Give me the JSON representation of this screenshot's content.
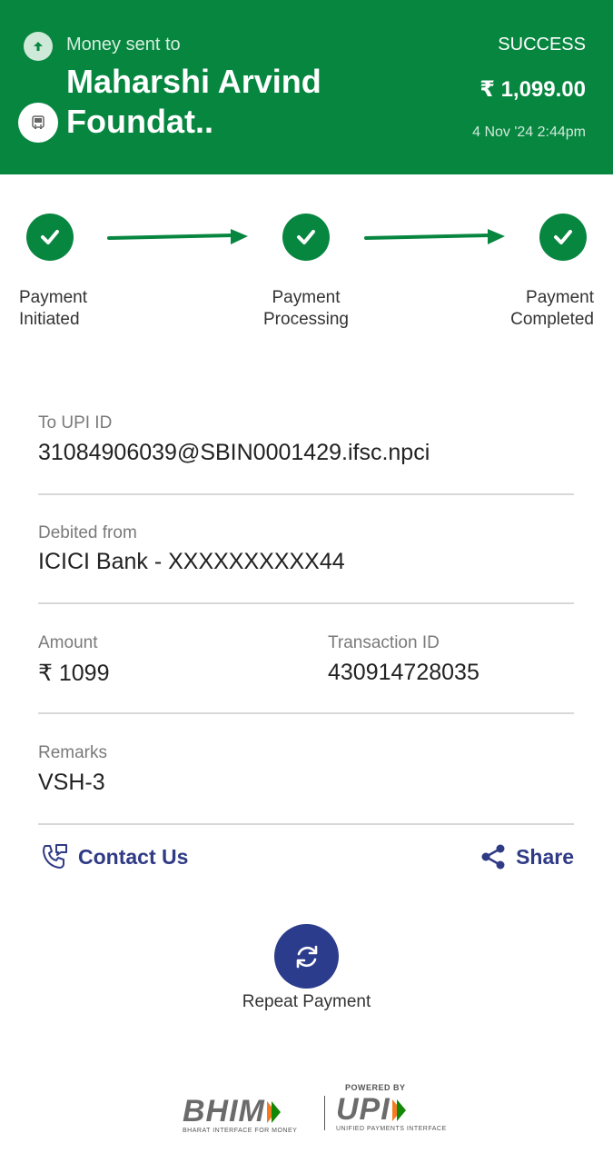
{
  "header": {
    "sent_label": "Money sent to",
    "name": "Maharshi Arvind Foundat..",
    "status": "SUCCESS",
    "amount": "₹ 1,099.00",
    "datetime": "4 Nov '24 2:44pm",
    "bg_color": "#078640"
  },
  "steps": [
    {
      "label_line1": "Payment",
      "label_line2": "Initiated"
    },
    {
      "label_line1": "Payment",
      "label_line2": "Processing"
    },
    {
      "label_line1": "Payment",
      "label_line2": "Completed"
    }
  ],
  "details": {
    "upi": {
      "label": "To UPI ID",
      "value": "31084906039@SBIN0001429.ifsc.npci"
    },
    "debited": {
      "label": "Debited from",
      "value": "ICICI Bank - XXXXXXXXXX44"
    },
    "amount": {
      "label": "Amount",
      "value": "₹ 1099"
    },
    "txn": {
      "label": "Transaction ID",
      "value": "430914728035"
    },
    "remarks": {
      "label": "Remarks",
      "value": "VSH-3"
    }
  },
  "actions": {
    "contact_label": "Contact Us",
    "share_label": "Share",
    "repeat_label": "Repeat Payment"
  },
  "footer": {
    "bhim_text": "BHIM",
    "bhim_tagline": "BHARAT INTERFACE FOR MONEY",
    "upi_powered": "POWERED BY",
    "upi_text": "UPI",
    "upi_tagline": "UNIFIED PAYMENTS INTERFACE"
  }
}
